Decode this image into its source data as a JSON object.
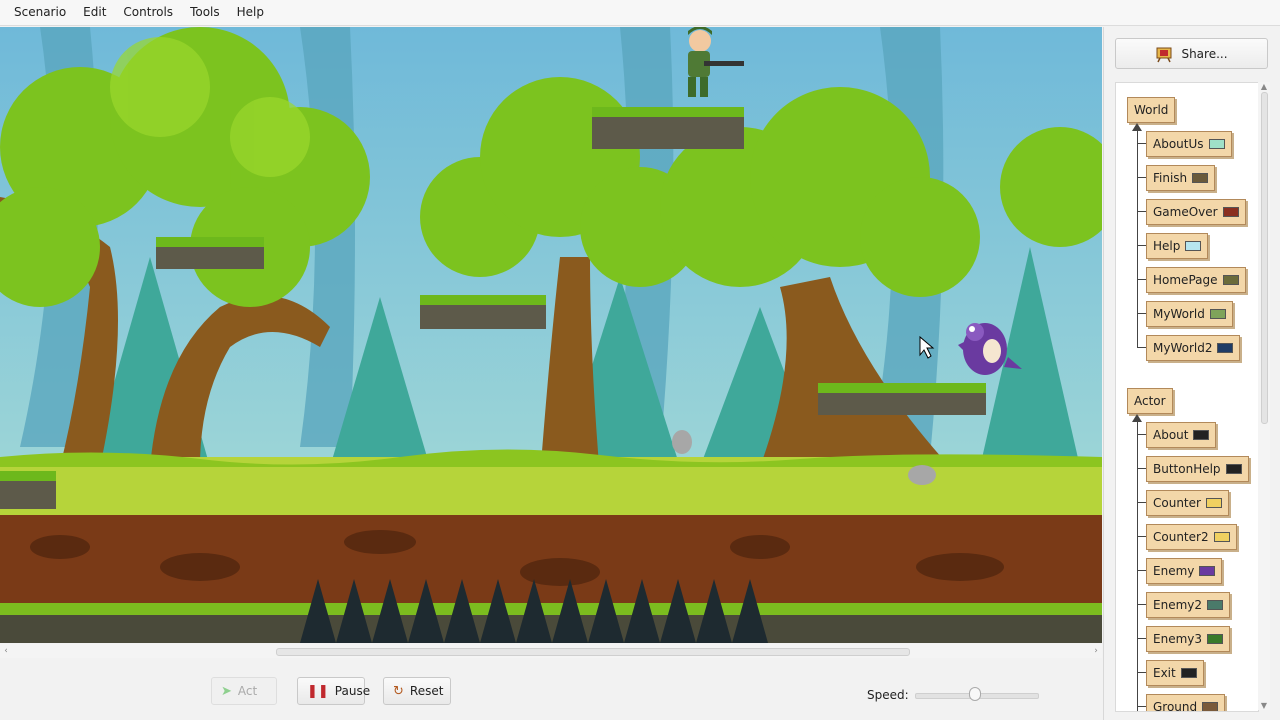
{
  "menu": [
    "Scenario",
    "Edit",
    "Controls",
    "Tools",
    "Help"
  ],
  "controls": {
    "act": "Act",
    "pause": "Pause",
    "reset": "Reset",
    "speed_label": "Speed:",
    "speed_value": 0.5
  },
  "share": {
    "label": "Share..."
  },
  "tree": {
    "world_root": "World",
    "world_classes": [
      {
        "name": "AboutUs",
        "icon": "aboutus-thumb",
        "color": "#9fe0c8"
      },
      {
        "name": "Finish",
        "icon": "finish-thumb",
        "color": "#6b5a3a"
      },
      {
        "name": "GameOver",
        "icon": "gameover-thumb",
        "color": "#8a2f20"
      },
      {
        "name": "Help",
        "icon": "help-thumb",
        "color": "#b7e6ef"
      },
      {
        "name": "HomePage",
        "icon": "homepage-thumb",
        "color": "#6b6b3a"
      },
      {
        "name": "MyWorld",
        "icon": "myworld-thumb",
        "color": "#7fa35a"
      },
      {
        "name": "MyWorld2",
        "icon": "myworld2-thumb",
        "color": "#1f3c66"
      }
    ],
    "actor_root": "Actor",
    "actor_classes": [
      {
        "name": "About",
        "icon": "about-thumb",
        "color": "#222222"
      },
      {
        "name": "ButtonHelp",
        "icon": "buttonhelp-thumb",
        "color": "#222222"
      },
      {
        "name": "Counter",
        "icon": "counter-thumb",
        "color": "#f0d060"
      },
      {
        "name": "Counter2",
        "icon": "counter2-thumb",
        "color": "#f0d060"
      },
      {
        "name": "Enemy",
        "icon": "enemy-thumb",
        "color": "#6a3aa0"
      },
      {
        "name": "Enemy2",
        "icon": "enemy2-thumb",
        "color": "#4a7a6a"
      },
      {
        "name": "Enemy3",
        "icon": "enemy3-thumb",
        "color": "#3a7a2a"
      },
      {
        "name": "Exit",
        "icon": "exit-thumb",
        "color": "#222222"
      },
      {
        "name": "Ground",
        "icon": "ground-thumb",
        "color": "#7a5a3a"
      }
    ]
  },
  "colors": {
    "class_fill": "#f3d7a9",
    "class_border": "#b2895a",
    "grass": "#7cbc1f",
    "sky": "#7fc3e0",
    "enemy": "#6a3aa0"
  }
}
